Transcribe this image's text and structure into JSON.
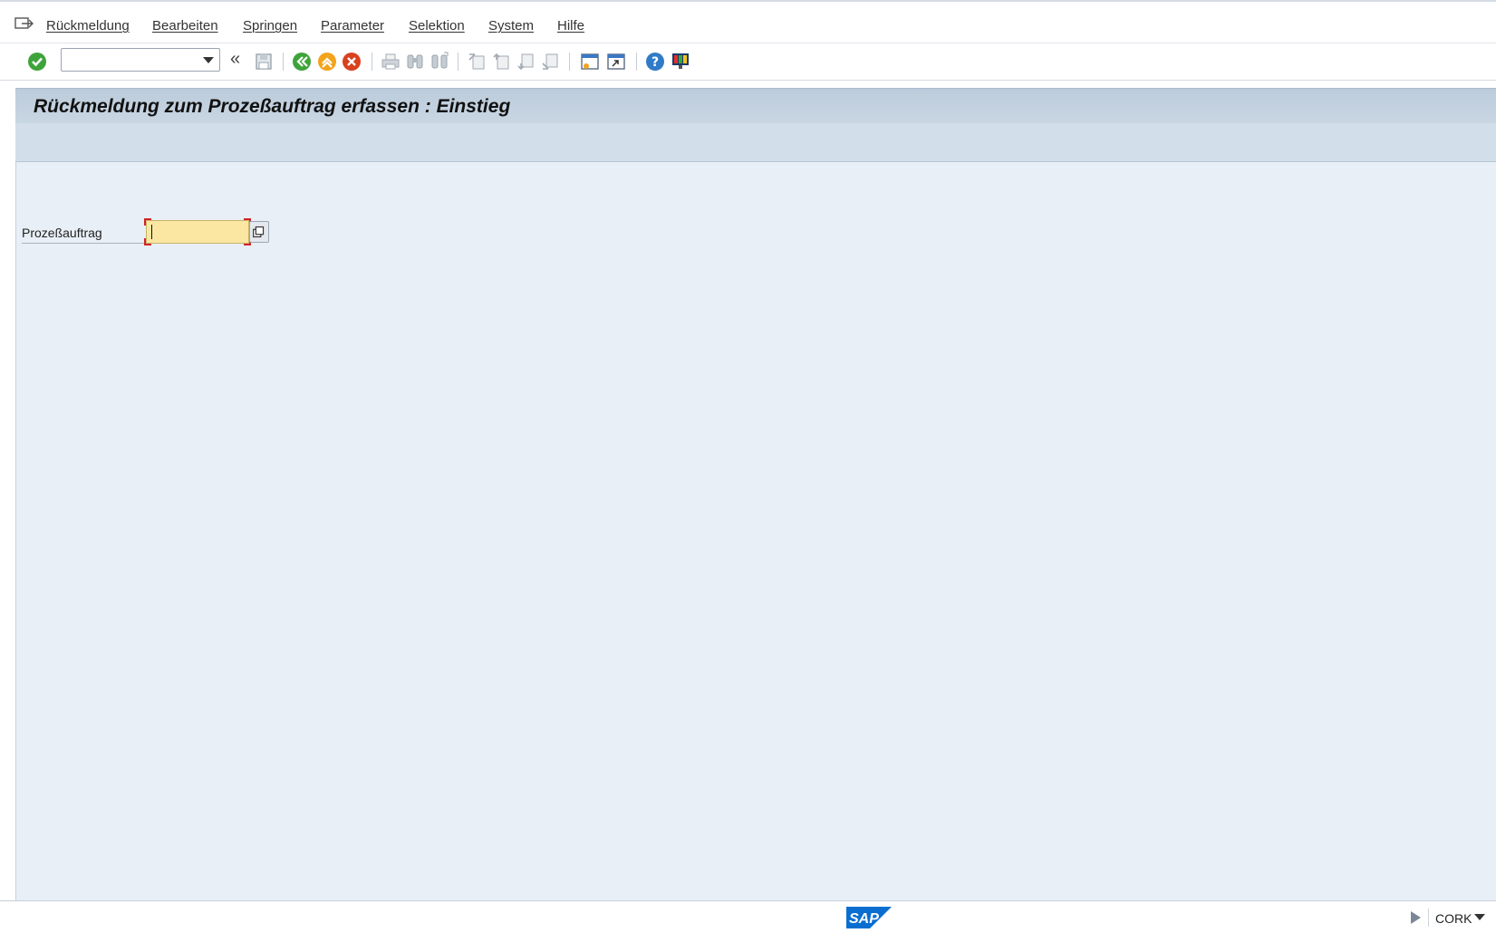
{
  "menu": {
    "items": [
      {
        "label": "Rückmeldung",
        "name": "menu-rueckmeldung"
      },
      {
        "label": "Bearbeiten",
        "name": "menu-bearbeiten"
      },
      {
        "label": "Springen",
        "name": "menu-springen"
      },
      {
        "label": "Parameter",
        "name": "menu-parameter"
      },
      {
        "label": "Selektion",
        "name": "menu-selektion"
      },
      {
        "label": "System",
        "name": "menu-system"
      },
      {
        "label": "Hilfe",
        "name": "menu-hilfe"
      }
    ]
  },
  "toolbar": {
    "command_value": "",
    "icons": [
      "enter-check-icon",
      "save-icon",
      "back-icon",
      "exit-icon",
      "cancel-icon",
      "print-icon",
      "find-icon",
      "find-next-icon",
      "first-page-icon",
      "previous-page-icon",
      "next-page-icon",
      "last-page-icon",
      "new-session-icon",
      "shortcut-icon",
      "help-icon",
      "customize-layout-icon"
    ]
  },
  "header": {
    "title": "Rückmeldung zum Prozeßauftrag erfassen : Einstieg"
  },
  "form": {
    "process_order_label": "Prozeßauftrag",
    "process_order_value": ""
  },
  "status": {
    "logo": "SAP",
    "system": "CORK"
  },
  "colors": {
    "title_bg": "#c4d3e1",
    "content_bg": "#e8eff6",
    "input_bg": "#fbe7a2",
    "required_marker": "#d2232a",
    "sap_blue": "#0a6ed1"
  }
}
